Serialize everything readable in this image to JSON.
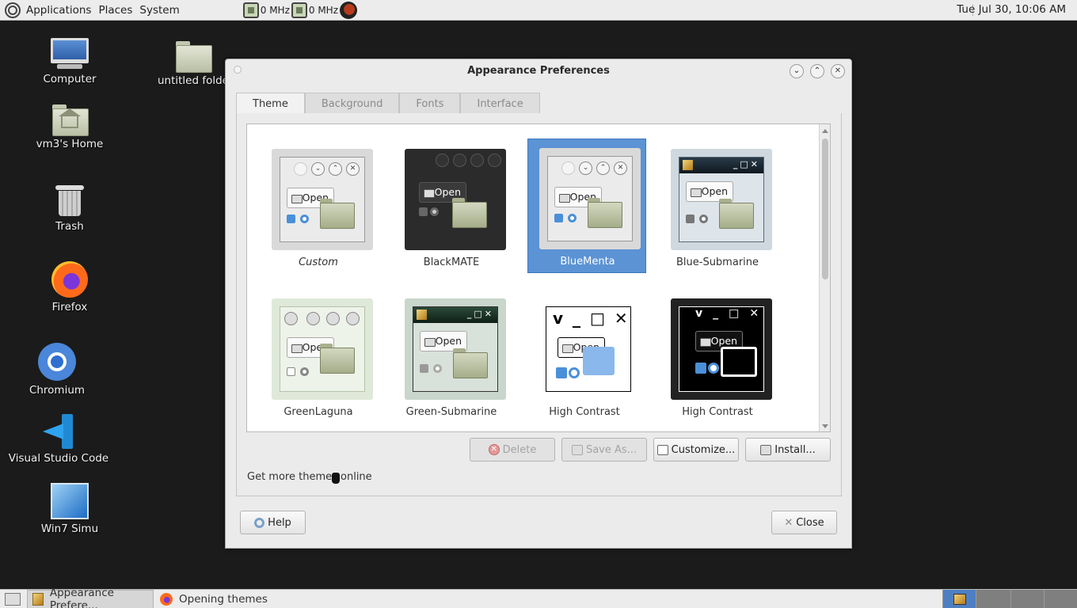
{
  "top_panel": {
    "menus": [
      "Applications",
      "Places",
      "System"
    ],
    "cpu1": "0 MHz",
    "cpu2": "0 MHz",
    "clock": "Tue Jul 30, 10:06 AM"
  },
  "desktop": {
    "icons": [
      {
        "label": "Computer",
        "icon": "computer-icon"
      },
      {
        "label": "untitled folde",
        "icon": "folder-icon"
      },
      {
        "label": "vm3's Home",
        "icon": "home-folder-icon"
      },
      {
        "label": "Trash",
        "icon": "trash-icon"
      },
      {
        "label": "Firefox",
        "icon": "firefox-icon"
      },
      {
        "label": "Chromium",
        "icon": "chromium-icon"
      },
      {
        "label": "Visual Studio Code",
        "icon": "vscode-icon"
      },
      {
        "label": "Win7 Simu",
        "icon": "win7-icon"
      }
    ]
  },
  "window": {
    "title": "Appearance Preferences",
    "tabs": [
      "Theme",
      "Background",
      "Fonts",
      "Interface"
    ],
    "active_tab": "Theme",
    "themes": [
      {
        "name": "Custom",
        "style": "light",
        "selected": false
      },
      {
        "name": "BlackMATE",
        "style": "dark",
        "selected": false
      },
      {
        "name": "BlueMenta",
        "style": "light",
        "selected": true
      },
      {
        "name": "Blue-Submarine",
        "style": "submarine",
        "selected": false
      },
      {
        "name": "GreenLaguna",
        "style": "green",
        "selected": false
      },
      {
        "name": "Green-Submarine",
        "style": "green-submarine",
        "selected": false
      },
      {
        "name": "High Contrast",
        "style": "high-contrast",
        "selected": false
      },
      {
        "name": "High Contrast",
        "style": "high-contrast-inverse",
        "selected": false
      }
    ],
    "preview_open_label": "Open",
    "buttons": {
      "delete": "Delete",
      "save_as": "Save As...",
      "customize": "Customize...",
      "install": "Install..."
    },
    "more_themes_link": "Get more themes online",
    "help": "Help",
    "close": "Close"
  },
  "bottom_panel": {
    "tasks": [
      {
        "label": "Appearance Prefere...",
        "active": true
      },
      {
        "label": "Opening themes",
        "active": false
      }
    ]
  },
  "colors": {
    "selection": "#5b93d4",
    "desktop_bg": "#1b1b1b"
  }
}
